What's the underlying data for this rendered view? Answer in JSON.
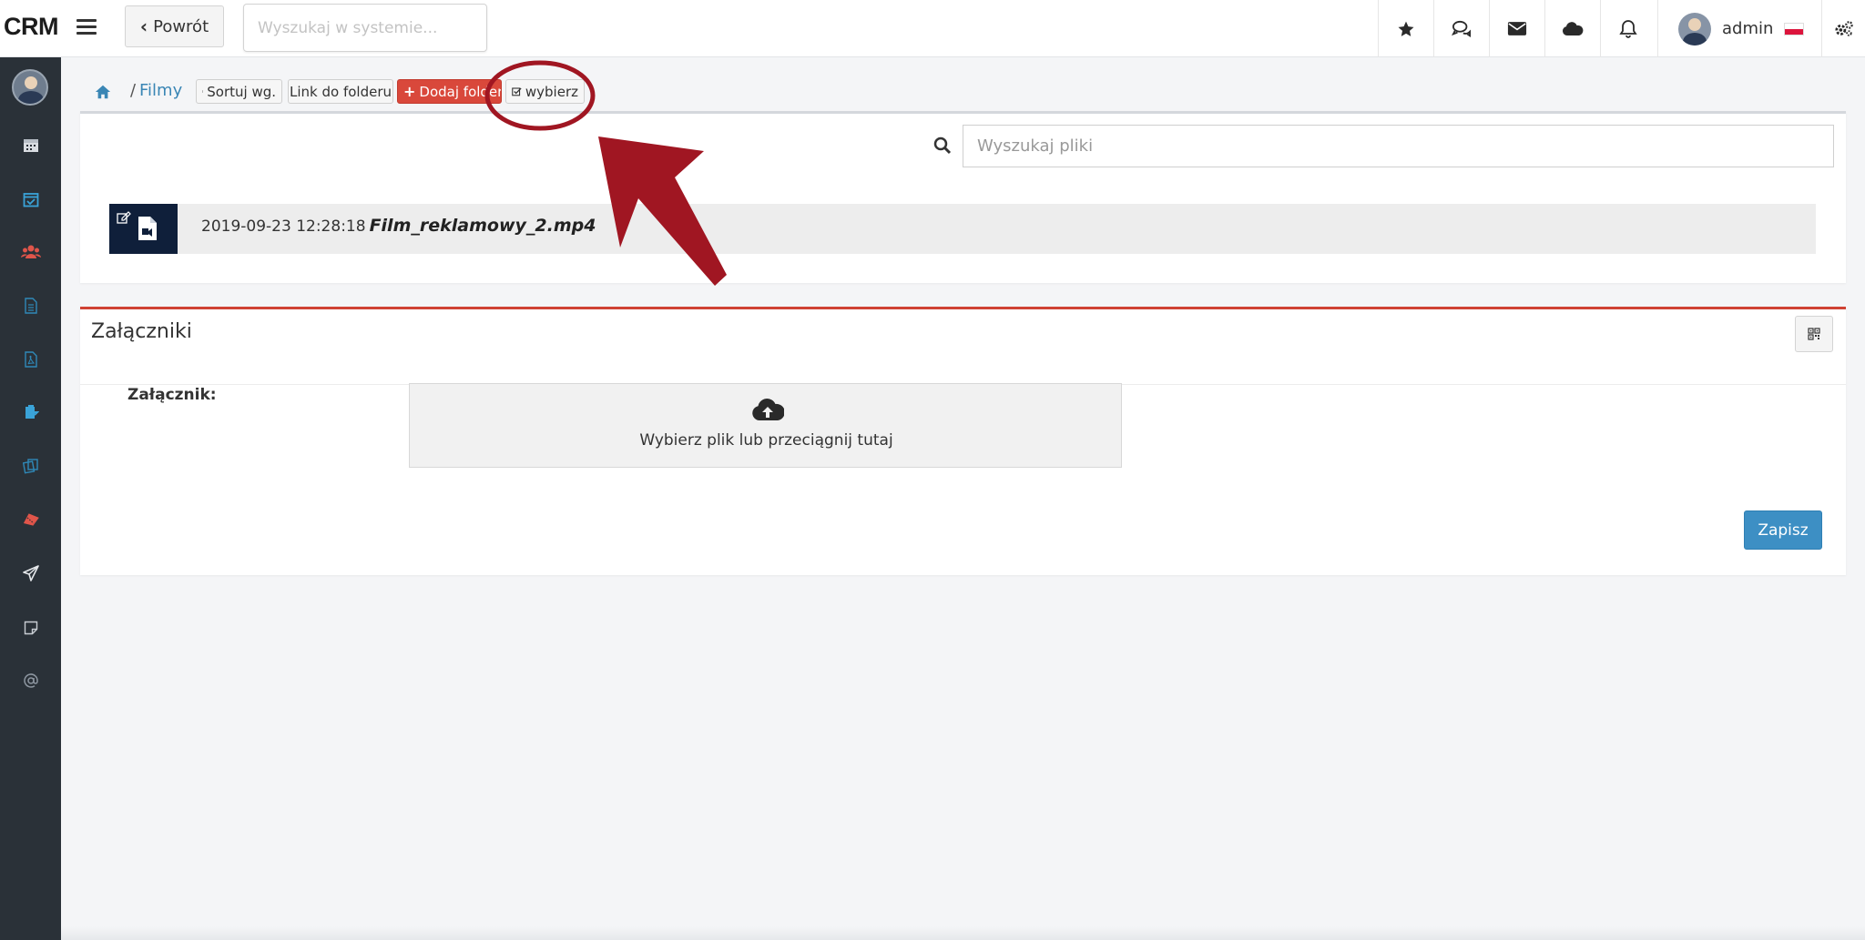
{
  "topbar": {
    "logo": "CRM",
    "back_label": "Powrót",
    "search_placeholder": "Wyszukaj w systemie...",
    "icons": [
      "star-icon",
      "comments-icon",
      "envelope-icon",
      "cloud-icon",
      "bell-icon"
    ],
    "user_name": "admin"
  },
  "sidebar": {
    "items": [
      "calendar-icon",
      "calendar-check-icon",
      "users-icon",
      "document-icon",
      "pdf-document-icon",
      "clipboard-icon",
      "copy-icon",
      "ticket-icon",
      "paper-plane-icon",
      "sticky-note-icon",
      "at-icon"
    ]
  },
  "breadcrumb": {
    "separator": "/",
    "current": "Filmy"
  },
  "toolbar": {
    "sort_label": "Sortuj wg.",
    "link_label": "Link do folderu",
    "add_folder_label": "Dodaj folder",
    "select_label": "wybierz"
  },
  "files": {
    "search_placeholder": "Wyszukaj pliki",
    "items": [
      {
        "date": "2019-09-23 12:28:18",
        "name": "Film_reklamowy_2.mp4"
      }
    ]
  },
  "attachments": {
    "title": "Załączniki",
    "label": "Załącznik:",
    "dropzone_text": "Wybierz plik  lub  przeciągnij tutaj",
    "save_label": "Zapisz"
  },
  "colors": {
    "accent_blue": "#3d8fc4",
    "accent_red": "#d9483b",
    "sidebar": "#2a3138",
    "annotation": "#a01622"
  }
}
